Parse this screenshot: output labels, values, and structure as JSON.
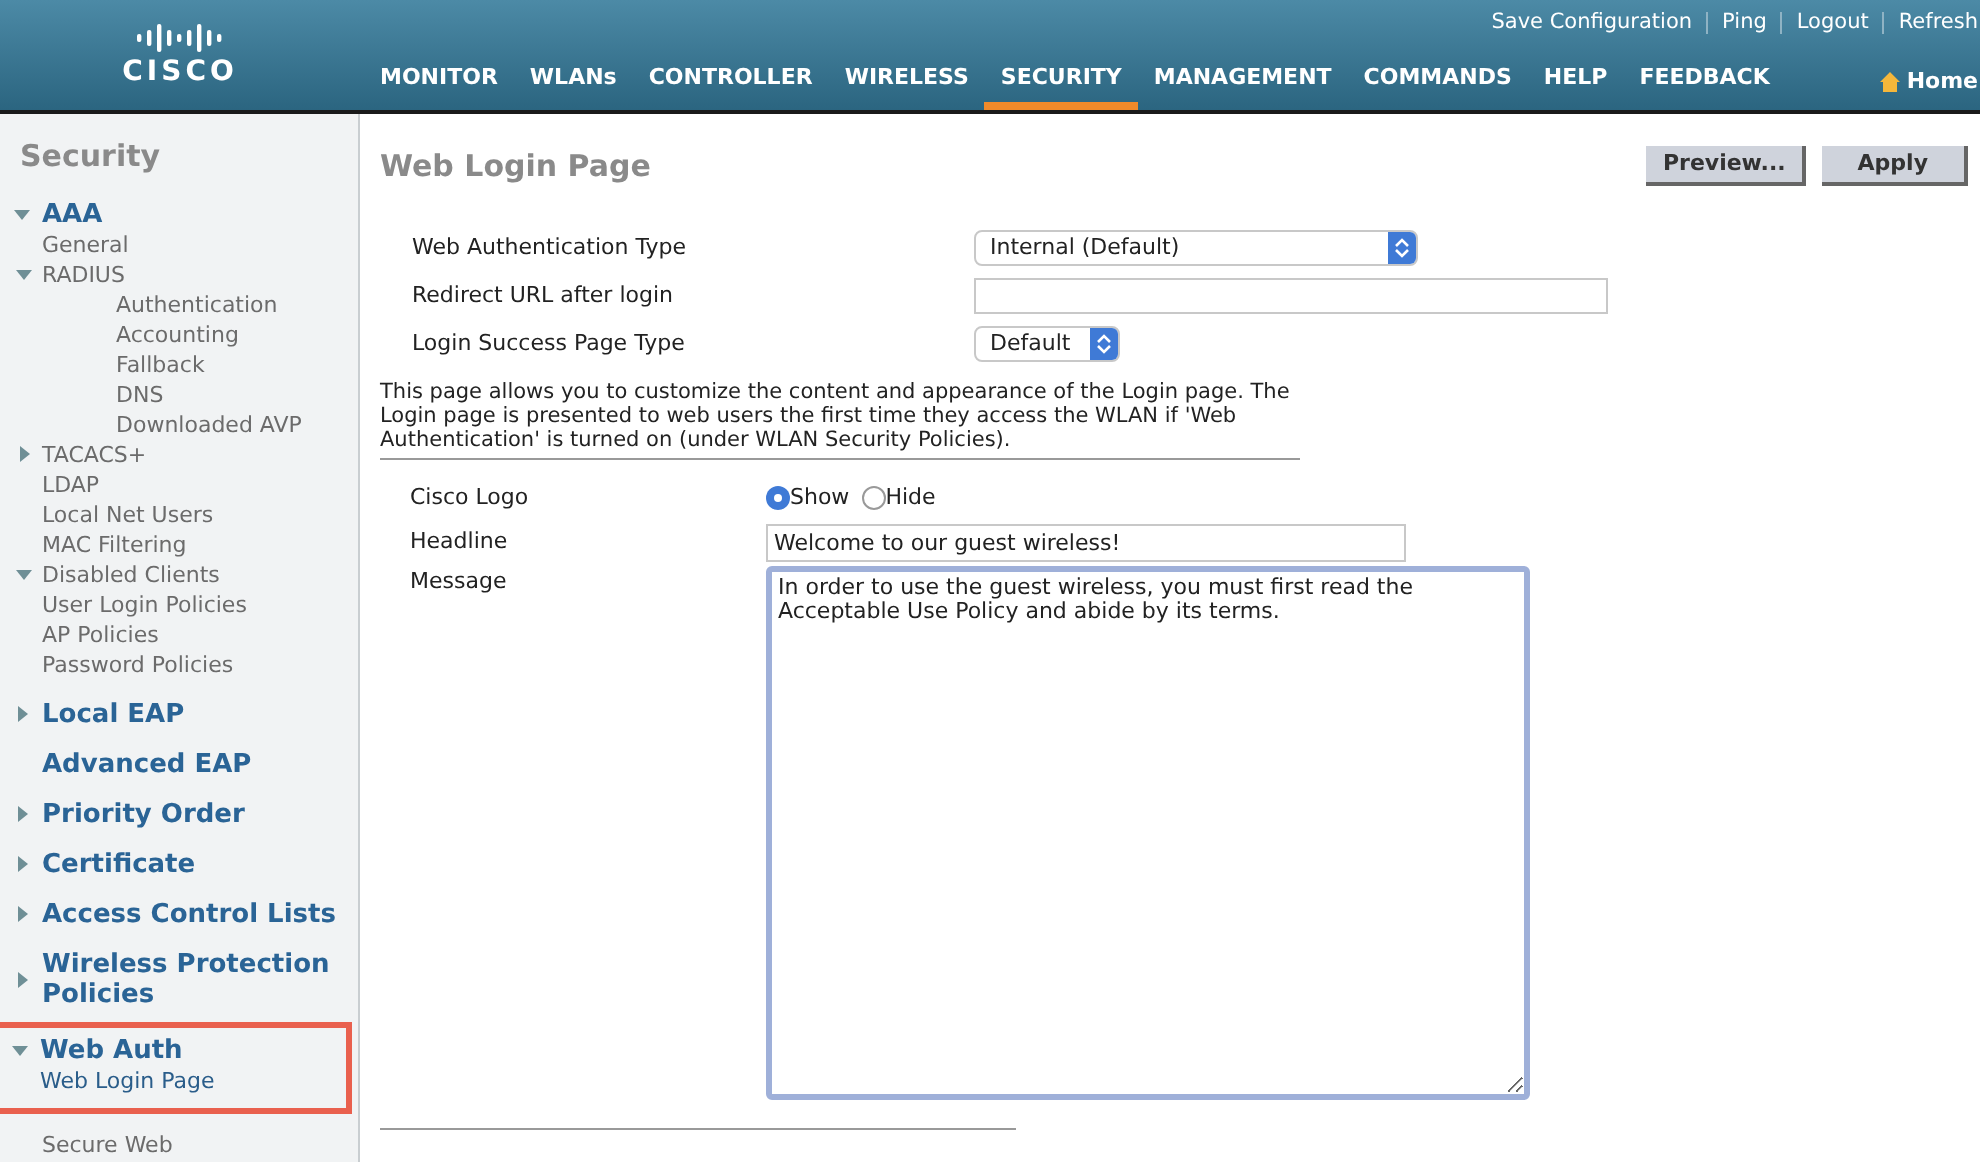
{
  "header": {
    "logo_text": "CISCO",
    "utility_links": [
      "Save Configuration",
      "Ping",
      "Logout",
      "Refresh"
    ],
    "nav": [
      {
        "label": "MONITOR",
        "selected": false
      },
      {
        "label": "WLANs",
        "selected": false
      },
      {
        "label": "CONTROLLER",
        "selected": false
      },
      {
        "label": "WIRELESS",
        "selected": false
      },
      {
        "label": "SECURITY",
        "selected": true
      },
      {
        "label": "MANAGEMENT",
        "selected": false
      },
      {
        "label": "COMMANDS",
        "selected": false
      },
      {
        "label": "HELP",
        "selected": false
      },
      {
        "label": "FEEDBACK",
        "selected": false
      }
    ],
    "home": "Home"
  },
  "sidebar": {
    "title": "Security",
    "items": [
      {
        "label": "AAA",
        "expanded": true,
        "highlighted": false,
        "children": [
          {
            "label": "General",
            "selected": false
          },
          {
            "label": "RADIUS",
            "expanded": true,
            "selected": false,
            "children": [
              {
                "label": "Authentication",
                "selected": false
              },
              {
                "label": "Accounting",
                "selected": false
              },
              {
                "label": "Fallback",
                "selected": false
              },
              {
                "label": "DNS",
                "selected": false
              },
              {
                "label": "Downloaded AVP",
                "selected": false
              }
            ]
          },
          {
            "label": "TACACS+",
            "expanded": false,
            "selected": false
          },
          {
            "label": "LDAP",
            "selected": false
          },
          {
            "label": "Local Net Users",
            "selected": false
          },
          {
            "label": "MAC Filtering",
            "selected": false
          },
          {
            "label": "Disabled Clients",
            "expanded": true,
            "selected": false
          },
          {
            "label": "User Login Policies",
            "selected": false
          },
          {
            "label": "AP Policies",
            "selected": false
          },
          {
            "label": "Password Policies",
            "selected": false
          }
        ]
      },
      {
        "label": "Local EAP",
        "expanded": false,
        "highlighted": false
      },
      {
        "label": "Advanced EAP",
        "highlighted": false
      },
      {
        "label": "Priority Order",
        "expanded": false,
        "highlighted": false
      },
      {
        "label": "Certificate",
        "expanded": false,
        "highlighted": false
      },
      {
        "label": "Access Control Lists",
        "expanded": false,
        "highlighted": false
      },
      {
        "label": "Wireless Protection Policies",
        "expanded": false,
        "highlighted": false
      },
      {
        "label": "Web Auth",
        "expanded": true,
        "highlighted": true,
        "children": [
          {
            "label": "Web Login Page",
            "selected": true
          }
        ]
      },
      {
        "label": "Secure Web",
        "selected": false
      }
    ]
  },
  "page": {
    "title": "Web Login Page",
    "buttons": [
      "Preview...",
      "Apply"
    ],
    "fields": [
      {
        "kind": "select",
        "label": "Web Authentication Type",
        "value": "Internal (Default)"
      },
      {
        "kind": "text",
        "label": "Redirect URL after login"
      },
      {
        "kind": "select",
        "label": "Login Success Page Type",
        "value": "Default"
      }
    ],
    "description": "This page allows you to customize the content and appearance of the Login page. The Login page is presented to web users the first time they access the WLAN if 'Web Authentication' is turned on (under WLAN Security Policies).",
    "cisco_logo": {
      "label": "Cisco Logo",
      "options": [
        {
          "label": "Show",
          "selected": true
        },
        {
          "label": "Hide",
          "selected": false
        }
      ]
    },
    "headline": {
      "label": "Headline",
      "value": "Welcome to our guest wireless!"
    },
    "message": {
      "label": "Message",
      "value": "In order to use the guest wireless, you must first read the\nAcceptable Use Policy and abide by its terms."
    }
  }
}
